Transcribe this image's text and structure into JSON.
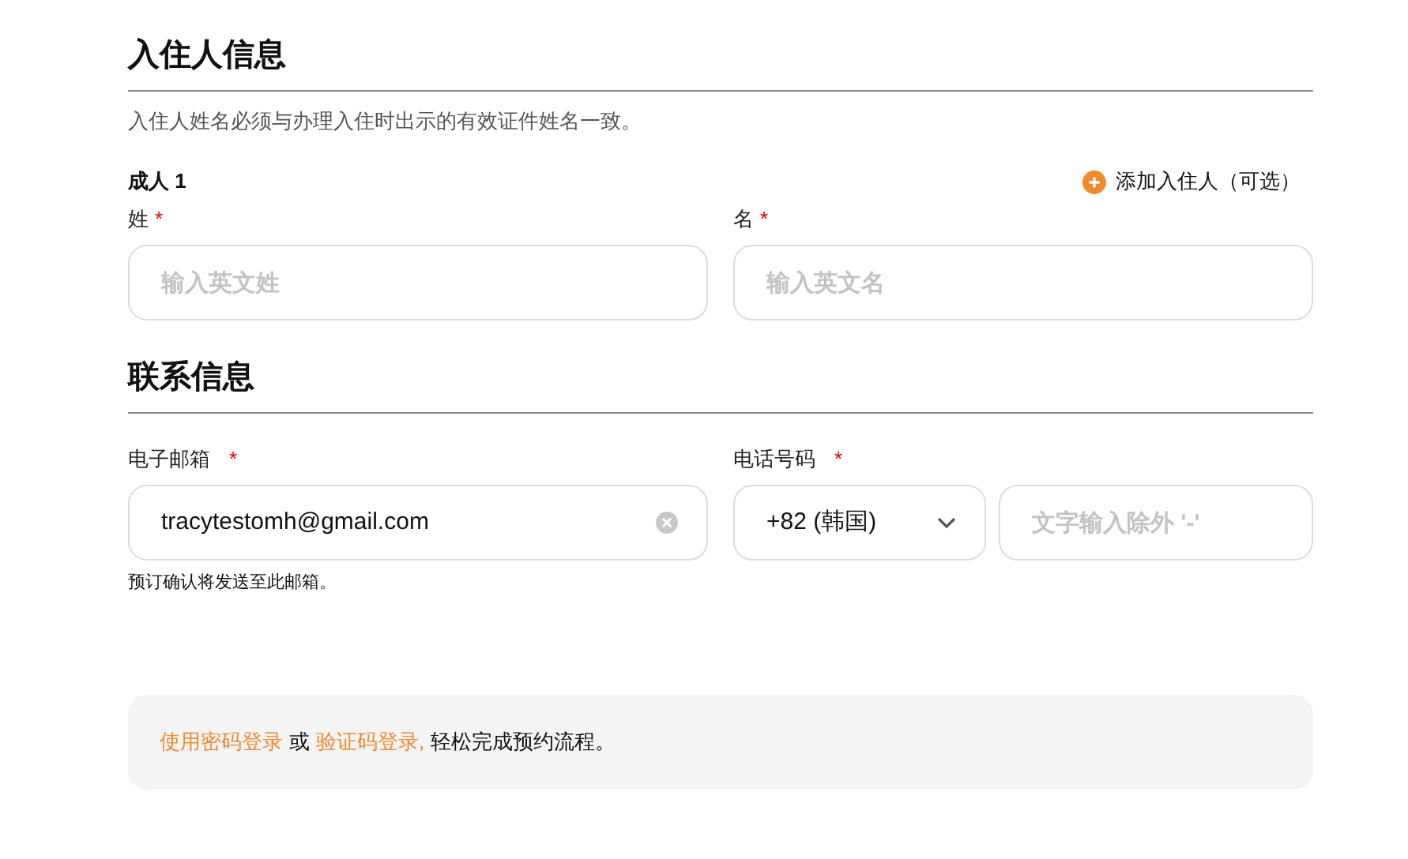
{
  "guest_section": {
    "title": "入住人信息",
    "note": "入住人姓名必须与办理入住时出示的有效证件姓名一致。",
    "guest_label": "成人 1",
    "add_guest": "添加入住人（可选）",
    "fields": [
      {
        "label": "姓",
        "required_mark": "*",
        "placeholder": "输入英文姓"
      },
      {
        "label": "名",
        "required_mark": "*",
        "placeholder": "输入英文名"
      }
    ]
  },
  "contact_section": {
    "title": "联系信息",
    "email": {
      "label": "电子邮箱",
      "required_mark": "*",
      "value": "tracytestomh@gmail.com",
      "hint": "预订确认将发送至此邮箱。"
    },
    "phone": {
      "label": "电话号码",
      "required_mark": "*",
      "country_code": "+82 (韩国)",
      "placeholder": "文字输入除外 '-'"
    }
  },
  "login_banner": {
    "password_link": "使用密码登录",
    "or": "或",
    "code_link": "验证码登录,",
    "rest": "轻松完成预约流程。"
  }
}
